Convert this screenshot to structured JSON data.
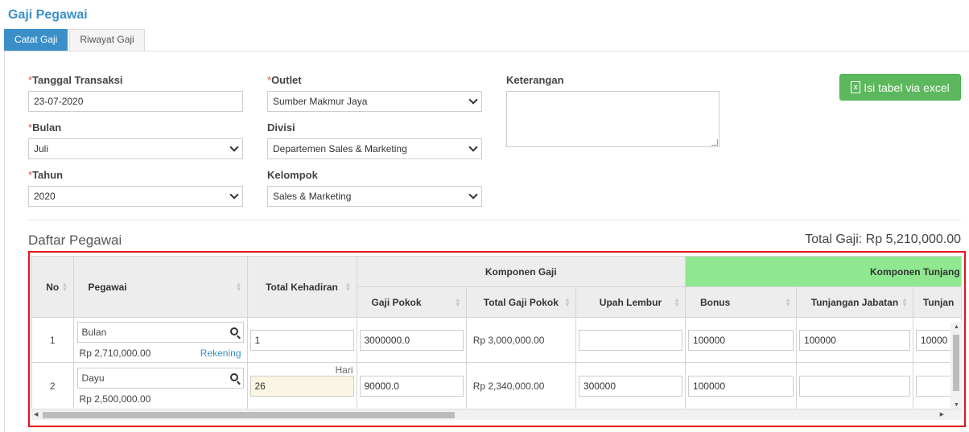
{
  "page": {
    "title": "Gaji Pegawai"
  },
  "tabs": [
    {
      "label": "Catat Gaji",
      "active": true
    },
    {
      "label": "Riwayat Gaji",
      "active": false
    }
  ],
  "form": {
    "tanggal": {
      "label": "Tanggal Transaksi",
      "value": "23-07-2020"
    },
    "bulan": {
      "label": "Bulan",
      "value": "Juli"
    },
    "tahun": {
      "label": "Tahun",
      "value": "2020"
    },
    "outlet": {
      "label": "Outlet",
      "value": "Sumber Makmur Jaya"
    },
    "divisi": {
      "label": "Divisi",
      "value": "Departemen Sales & Marketing"
    },
    "kelompok": {
      "label": "Kelompok",
      "value": "Sales & Marketing"
    },
    "keterangan": {
      "label": "Keterangan",
      "value": ""
    },
    "required_mark": "*"
  },
  "excel_button": {
    "label": "Isi tabel via excel",
    "icon": "excel-file-icon",
    "color": "#5cb85c"
  },
  "section": {
    "title": "Daftar Pegawai",
    "total_label": "Total Gaji: Rp 5,210,000.00"
  },
  "table": {
    "headers": {
      "no": "No",
      "pegawai": "Pegawai",
      "kehadiran": "Total Kehadiran",
      "komponen_gaji": "Komponen Gaji",
      "komponen_tunjangan": "Komponen Tunjang",
      "gaji_pokok": "Gaji Pokok",
      "total_gaji_pokok": "Total Gaji Pokok",
      "upah_lembur": "Upah Lembur",
      "bonus": "Bonus",
      "tunjangan_jabatan": "Tunjangan Jabatan",
      "tunjangan_more": "Tunjan"
    },
    "rows": [
      {
        "no": "1",
        "pegawai": "Bulan",
        "salary": "Rp 2,710,000.00",
        "rekening": "Rekening",
        "kehadiran": "1",
        "hari": "",
        "gaji_pokok": "3000000.0",
        "total_gaji_pokok": "Rp 3,000,000.00",
        "upah_lembur": "",
        "bonus": "100000",
        "tunjangan_jabatan": "100000",
        "tunjangan_more": "10000"
      },
      {
        "no": "2",
        "pegawai": "Dayu",
        "salary": "Rp 2,500,000.00",
        "rekening": "",
        "kehadiran": "26",
        "hari": "Hari",
        "gaji_pokok": "90000.0",
        "total_gaji_pokok": "Rp 2,340,000.00",
        "upah_lembur": "300000",
        "bonus": "100000",
        "tunjangan_jabatan": "",
        "tunjangan_more": ""
      }
    ]
  },
  "colors": {
    "accent": "#3a8fc9",
    "highlight": "#e8141b",
    "tunjangan_header": "#8fe88f"
  }
}
